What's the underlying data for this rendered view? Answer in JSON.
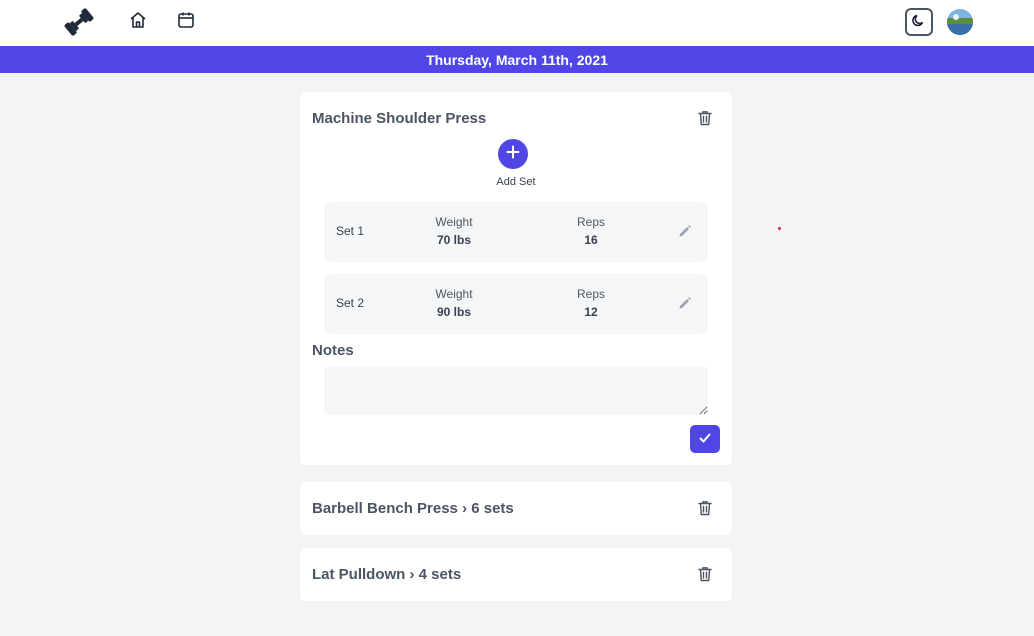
{
  "header": {
    "logo_icon": "dumbbell-icon",
    "nav": [
      {
        "name": "home",
        "icon": "home-icon"
      },
      {
        "name": "calendar",
        "icon": "calendar-icon"
      }
    ],
    "theme_toggle_icon": "moon-icon",
    "avatar": "user-avatar"
  },
  "date_banner": "Thursday, March 11th, 2021",
  "colors": {
    "accent": "#4f46e5",
    "card": "#ffffff",
    "background": "#f3f4f6",
    "row": "#f5f6f8"
  },
  "exercises": [
    {
      "title": "Machine Shoulder Press",
      "expanded": true,
      "add_set_label": "Add Set",
      "sets": [
        {
          "name": "Set 1",
          "weight_label": "Weight",
          "weight": "70 lbs",
          "reps_label": "Reps",
          "reps": "16"
        },
        {
          "name": "Set 2",
          "weight_label": "Weight",
          "weight": "90 lbs",
          "reps_label": "Reps",
          "reps": "12"
        }
      ],
      "notes_label": "Notes",
      "notes_value": ""
    },
    {
      "title": "Barbell Bench Press › 6 sets",
      "expanded": false
    },
    {
      "title": "Lat Pulldown › 4 sets",
      "expanded": false
    }
  ]
}
